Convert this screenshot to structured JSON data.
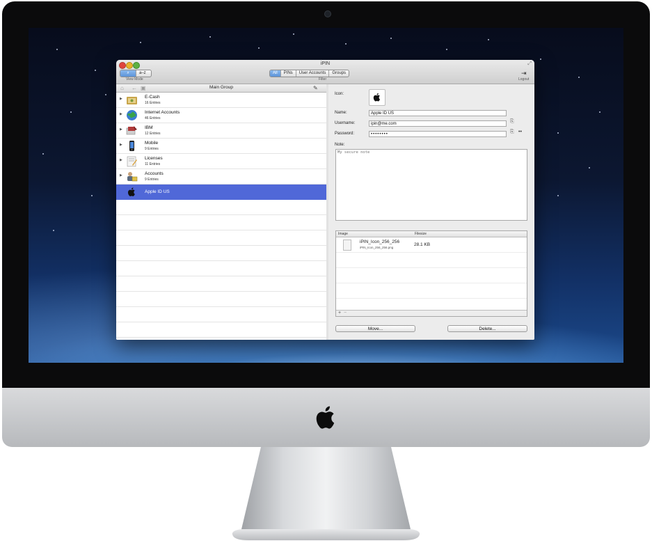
{
  "window": {
    "title": "iPIN"
  },
  "toolbar": {
    "view_mode": {
      "options": [
        "a–z"
      ],
      "label": "View Mode"
    },
    "filter": {
      "options": [
        "All",
        "PINs",
        "User Accounts",
        "Groups"
      ],
      "label": "Filter"
    },
    "logout_label": "Logout"
  },
  "left_pane": {
    "header_title": "Main Group",
    "items": [
      {
        "name": "E-Cash",
        "entries": "16 Entries",
        "icon": "ecash-icon"
      },
      {
        "name": "Internet Accounts",
        "entries": "46 Entries",
        "icon": "globe-icon"
      },
      {
        "name": "IBM",
        "entries": "12 Entries",
        "icon": "ibm-icon"
      },
      {
        "name": "Mobile",
        "entries": "9 Entries",
        "icon": "phone-icon"
      },
      {
        "name": "Licenses",
        "entries": "11 Entries",
        "icon": "license-icon"
      },
      {
        "name": "Accounts",
        "entries": "9 Entries",
        "icon": "accounts-icon"
      },
      {
        "name": "Apple ID US",
        "entries": "",
        "icon": "apple-icon",
        "selected": true
      }
    ]
  },
  "detail": {
    "icon_label": "Icon:",
    "name_label": "Name:",
    "name_value": "Apple ID US",
    "username_label": "Username:",
    "username_value": "ipin@me.com",
    "password_label": "Password:",
    "password_value": "••••••••",
    "note_label": "Note:",
    "note_value": "My secure note",
    "files": {
      "columns": [
        "Image",
        "Filesize"
      ],
      "rows": [
        {
          "name": "iPIN_Icon_256_256",
          "path": "iPIN_Icon_256_256.png",
          "size": "28.1 KB"
        }
      ],
      "add": "+",
      "remove": "−"
    },
    "move_button": "Move...",
    "delete_button": "Delete..."
  },
  "colors": {
    "selection": "#5068d8",
    "accent": "#5c93d8"
  }
}
